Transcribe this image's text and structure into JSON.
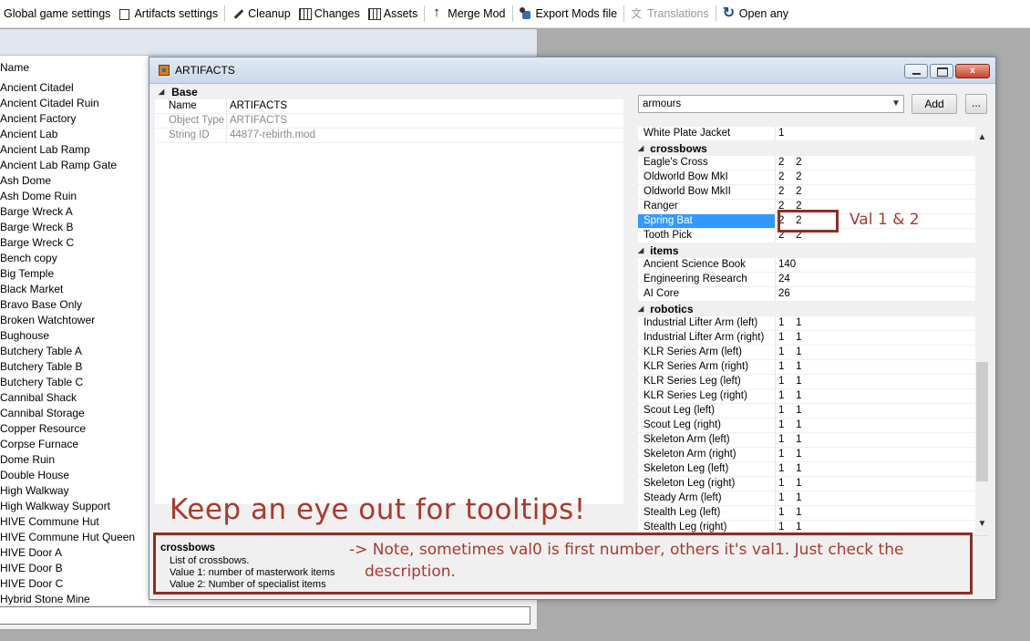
{
  "toolbar": {
    "items": [
      {
        "label": "Global game settings",
        "icon": "none"
      },
      {
        "label": "Artifacts settings",
        "icon": "box-icon"
      },
      {
        "label": "Cleanup",
        "icon": "broom-icon"
      },
      {
        "label": "Changes",
        "icon": "changes-icon"
      },
      {
        "label": "Assets",
        "icon": "assets-icon"
      },
      {
        "label": "Merge Mod",
        "icon": "merge-icon"
      },
      {
        "label": "Export Mods file",
        "icon": "export-icon"
      },
      {
        "label": "Translations",
        "icon": "translate-icon",
        "disabled": true
      },
      {
        "label": "Open any",
        "icon": "refresh-icon"
      }
    ]
  },
  "bg_list": {
    "header": "Name",
    "items": [
      "Ancient Citadel",
      "Ancient Citadel Ruin",
      "Ancient Factory",
      "Ancient Lab",
      "Ancient Lab Ramp",
      "Ancient Lab Ramp Gate",
      "Ash Dome",
      "Ash Dome Ruin",
      "Barge Wreck A",
      "Barge Wreck B",
      "Barge Wreck C",
      "Bench copy",
      "Big Temple",
      "Black Market",
      "Bravo Base Only",
      "Broken Watchtower",
      "Bughouse",
      "Butchery Table A",
      "Butchery Table B",
      "Butchery Table C",
      "Cannibal Shack",
      "Cannibal Storage",
      "Copper Resource",
      "Corpse Furnace",
      "Dome Ruin",
      "Double House",
      "High Walkway",
      "High Walkway Support",
      "HIVE Commune Hut",
      "HIVE Commune Hut Queen",
      "HIVE Door A",
      "HIVE Door B",
      "HIVE Door C",
      "Hybrid Stone Mine"
    ]
  },
  "dialog": {
    "title": "ARTIFACTS",
    "close_glyph": "x",
    "base": {
      "category": "Base",
      "rows": [
        {
          "key": "Name",
          "value": "ARTIFACTS",
          "readonly": false
        },
        {
          "key": "Object Type",
          "value": "ARTIFACTS",
          "readonly": true
        },
        {
          "key": "String ID",
          "value": "44877-rebirth.mod",
          "readonly": true
        }
      ]
    },
    "combo_value": "armours",
    "add_label": "Add",
    "more_label": "...",
    "grid": [
      {
        "type": "row",
        "key": "White Plate Jacket",
        "value": "1"
      },
      {
        "type": "cat",
        "label": "crossbows"
      },
      {
        "type": "row",
        "key": "Eagle's Cross",
        "value": "2    2"
      },
      {
        "type": "row",
        "key": "Oldworld Bow MkI",
        "value": "2    2"
      },
      {
        "type": "row",
        "key": "Oldworld Bow MkII",
        "value": "2    2"
      },
      {
        "type": "row",
        "key": "Ranger",
        "value": "2    2"
      },
      {
        "type": "row",
        "key": "Spring Bat",
        "value": "2    2",
        "selected": true
      },
      {
        "type": "row",
        "key": "Tooth Pick",
        "value": "2    2"
      },
      {
        "type": "cat",
        "label": "items"
      },
      {
        "type": "row",
        "key": "Ancient Science Book",
        "value": "140"
      },
      {
        "type": "row",
        "key": "Engineering Research",
        "value": "24"
      },
      {
        "type": "row",
        "key": "AI Core",
        "value": "26"
      },
      {
        "type": "cat",
        "label": "robotics"
      },
      {
        "type": "row",
        "key": "Industrial Lifter Arm (left)",
        "value": "1    1"
      },
      {
        "type": "row",
        "key": "Industrial Lifter Arm (right)",
        "value": "1    1"
      },
      {
        "type": "row",
        "key": "KLR Series Arm (left)",
        "value": "1    1"
      },
      {
        "type": "row",
        "key": "KLR Series Arm (right)",
        "value": "1    1"
      },
      {
        "type": "row",
        "key": "KLR Series Leg (left)",
        "value": "1    1"
      },
      {
        "type": "row",
        "key": "KLR Series Leg (right)",
        "value": "1    1"
      },
      {
        "type": "row",
        "key": "Scout Leg (left)",
        "value": "1    1"
      },
      {
        "type": "row",
        "key": "Scout Leg (right)",
        "value": "1    1"
      },
      {
        "type": "row",
        "key": "Skeleton Arm (left)",
        "value": "1    1"
      },
      {
        "type": "row",
        "key": "Skeleton Arm (right)",
        "value": "1    1"
      },
      {
        "type": "row",
        "key": "Skeleton Leg (left)",
        "value": "1    1"
      },
      {
        "type": "row",
        "key": "Skeleton Leg (right)",
        "value": "1    1"
      },
      {
        "type": "row",
        "key": "Steady Arm (left)",
        "value": "1    1"
      },
      {
        "type": "row",
        "key": "Stealth Leg (left)",
        "value": "1    1"
      },
      {
        "type": "row",
        "key": "Stealth Leg (right)",
        "value": "1    1"
      }
    ],
    "help": {
      "title": "crossbows",
      "lines": [
        "List of crossbows.",
        "Value 1: number of masterwork items",
        "Value 2: Number of specialist items"
      ]
    }
  },
  "annotations": {
    "val_label": "Val 1 & 2",
    "tooltips_note": "Keep an eye out for tooltips!",
    "note_line1": "-> Note, sometimes val0 is first number, others it's val1. Just check the",
    "note_line2": "description.",
    "color": "#a83a2f"
  },
  "colors": {
    "selection": "#3399ff",
    "annotation_border": "#8b2e28"
  }
}
